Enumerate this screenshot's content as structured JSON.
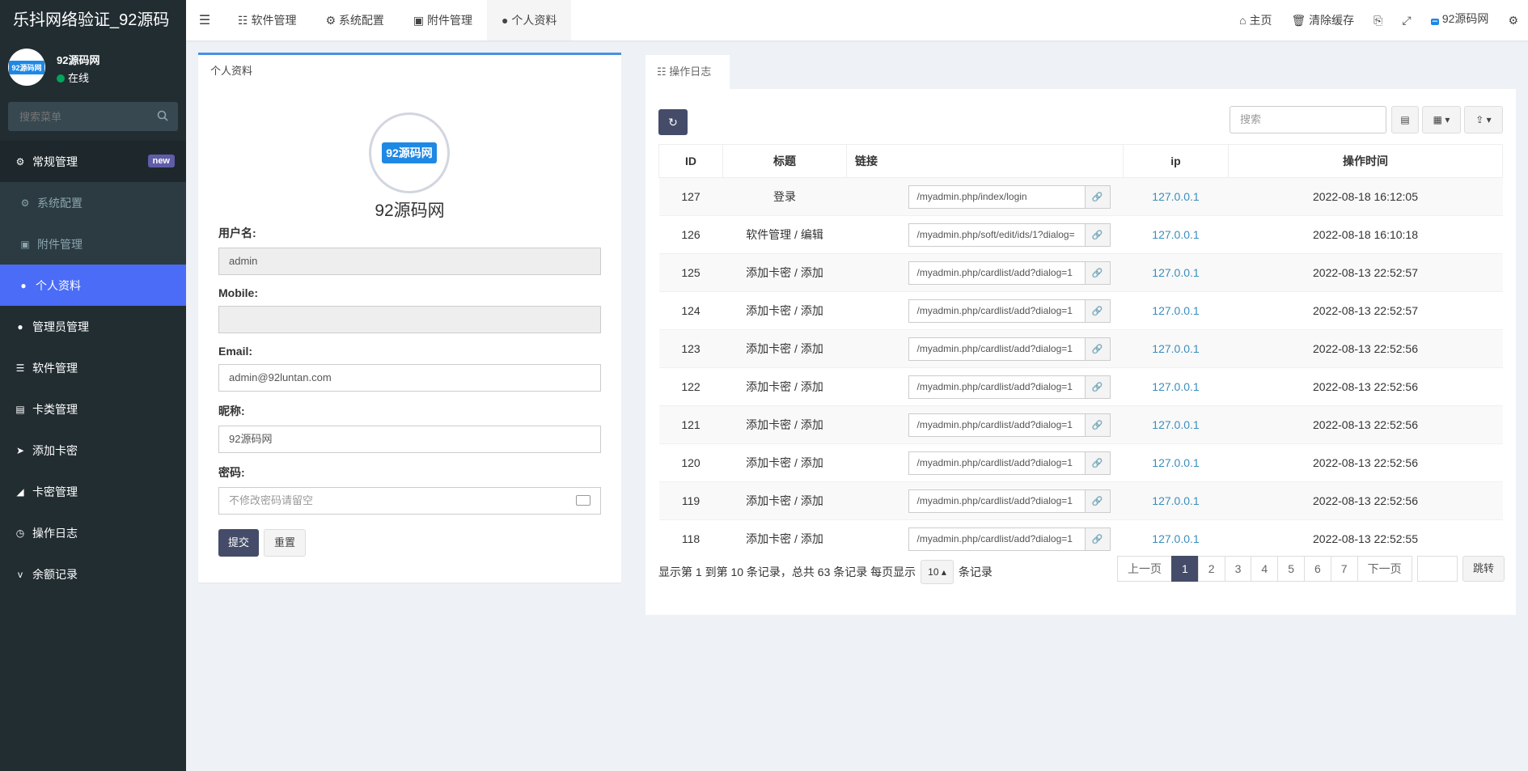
{
  "brand": "乐抖网络验证_92源码",
  "user": {
    "name": "92源码网",
    "status": "在线",
    "logo_text": "92源码网"
  },
  "sidebar": {
    "search_placeholder": "搜索菜单",
    "items": [
      {
        "label": "常规管理",
        "badge": "new"
      },
      {
        "label": "系统配置"
      },
      {
        "label": "附件管理"
      },
      {
        "label": "个人资料"
      },
      {
        "label": "管理员管理"
      },
      {
        "label": "软件管理"
      },
      {
        "label": "卡类管理"
      },
      {
        "label": "添加卡密"
      },
      {
        "label": "卡密管理"
      },
      {
        "label": "操作日志"
      },
      {
        "label": "余额记录"
      }
    ]
  },
  "topbar": {
    "tabs": [
      "软件管理",
      "系统配置",
      "附件管理",
      "个人资料"
    ],
    "right": {
      "home": "主页",
      "clear_cache": "清除缓存",
      "username": "92源码网"
    }
  },
  "profile": {
    "panel_title": "个人资料",
    "logo_text": "92源码网",
    "nickname_display": "92源码网",
    "fields": {
      "username_label": "用户名:",
      "username_value": "admin",
      "mobile_label": "Mobile:",
      "mobile_value": "",
      "email_label": "Email:",
      "email_value": "admin@92luntan.com",
      "nick_label": "昵称:",
      "nick_value": "92源码网",
      "password_label": "密码:",
      "password_placeholder": "不修改密码请留空"
    },
    "submit": "提交",
    "reset": "重置"
  },
  "log": {
    "tab": "操作日志",
    "search_placeholder": "搜索",
    "columns": [
      "ID",
      "标题",
      "链接",
      "ip",
      "操作时间"
    ],
    "rows": [
      {
        "id": "127",
        "title": "登录",
        "url": "/myadmin.php/index/login",
        "ip": "127.0.0.1",
        "time": "2022-08-18 16:12:05"
      },
      {
        "id": "126",
        "title": "软件管理 / 编辑",
        "url": "/myadmin.php/soft/edit/ids/1?dialog=",
        "ip": "127.0.0.1",
        "time": "2022-08-18 16:10:18"
      },
      {
        "id": "125",
        "title": "添加卡密 / 添加",
        "url": "/myadmin.php/cardlist/add?dialog=1",
        "ip": "127.0.0.1",
        "time": "2022-08-13 22:52:57"
      },
      {
        "id": "124",
        "title": "添加卡密 / 添加",
        "url": "/myadmin.php/cardlist/add?dialog=1",
        "ip": "127.0.0.1",
        "time": "2022-08-13 22:52:57"
      },
      {
        "id": "123",
        "title": "添加卡密 / 添加",
        "url": "/myadmin.php/cardlist/add?dialog=1",
        "ip": "127.0.0.1",
        "time": "2022-08-13 22:52:56"
      },
      {
        "id": "122",
        "title": "添加卡密 / 添加",
        "url": "/myadmin.php/cardlist/add?dialog=1",
        "ip": "127.0.0.1",
        "time": "2022-08-13 22:52:56"
      },
      {
        "id": "121",
        "title": "添加卡密 / 添加",
        "url": "/myadmin.php/cardlist/add?dialog=1",
        "ip": "127.0.0.1",
        "time": "2022-08-13 22:52:56"
      },
      {
        "id": "120",
        "title": "添加卡密 / 添加",
        "url": "/myadmin.php/cardlist/add?dialog=1",
        "ip": "127.0.0.1",
        "time": "2022-08-13 22:52:56"
      },
      {
        "id": "119",
        "title": "添加卡密 / 添加",
        "url": "/myadmin.php/cardlist/add?dialog=1",
        "ip": "127.0.0.1",
        "time": "2022-08-13 22:52:56"
      },
      {
        "id": "118",
        "title": "添加卡密 / 添加",
        "url": "/myadmin.php/cardlist/add?dialog=1",
        "ip": "127.0.0.1",
        "time": "2022-08-13 22:52:55"
      }
    ],
    "page_info_prefix": "显示第 1 到第 10 条记录，总共 63 条记录 每页显示",
    "page_size": "10",
    "page_info_suffix": "条记录",
    "pager": [
      "上一页",
      "1",
      "2",
      "3",
      "4",
      "5",
      "6",
      "7",
      "下一页"
    ],
    "jump": "跳转"
  }
}
